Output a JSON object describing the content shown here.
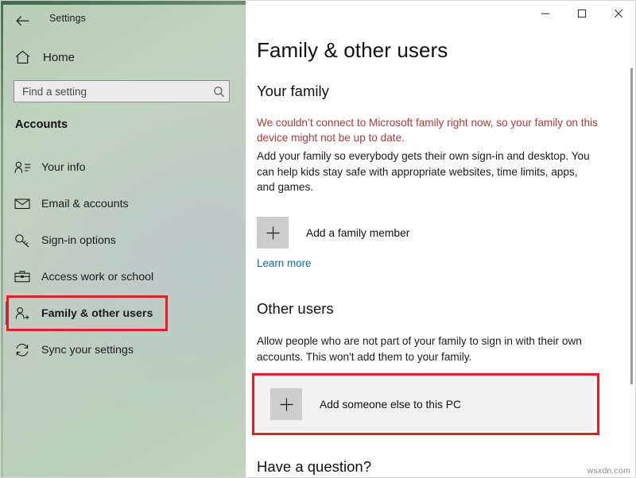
{
  "window": {
    "title": "Settings",
    "back_icon": "back-arrow-icon",
    "controls": {
      "minimize": "minimize-icon",
      "maximize": "maximize-icon",
      "close": "close-icon"
    }
  },
  "sidebar": {
    "home": {
      "label": "Home",
      "icon": "home-icon"
    },
    "search": {
      "value": "",
      "placeholder": "Find a setting",
      "icon": "search-icon"
    },
    "category": "Accounts",
    "items": [
      {
        "label": "Your info",
        "icon": "user-info-icon",
        "selected": false
      },
      {
        "label": "Email & accounts",
        "icon": "envelope-icon",
        "selected": false
      },
      {
        "label": "Sign-in options",
        "icon": "key-icon",
        "selected": false
      },
      {
        "label": "Access work or school",
        "icon": "briefcase-icon",
        "selected": false
      },
      {
        "label": "Family & other users",
        "icon": "user-add-icon",
        "selected": true
      },
      {
        "label": "Sync your settings",
        "icon": "sync-icon",
        "selected": false
      }
    ],
    "selection_accent": "#0a67c8",
    "highlight_color": "#e02020"
  },
  "main": {
    "page_title": "Family & other users",
    "your_family": {
      "heading": "Your family",
      "error": "We couldn’t connect to Microsoft family right now, so your family on this device might not be up to date.",
      "error_color": "#ab3b3b",
      "description": "Add your family so everybody gets their own sign-in and desktop. You can help kids stay safe with appropriate websites, time limits, apps, and games.",
      "add_member_label": "Add a family member",
      "add_member_icon": "plus-icon",
      "learn_more_label": "Learn more",
      "link_color": "#0a6cbf"
    },
    "other_users": {
      "heading": "Other users",
      "description": "Allow people who are not part of your family to sign in with their own accounts. This won't add them to your family.",
      "add_someone_label": "Add someone else to this PC",
      "add_someone_icon": "plus-icon"
    },
    "have_question_heading": "Have a question?"
  },
  "watermark": "wsxdn.com"
}
